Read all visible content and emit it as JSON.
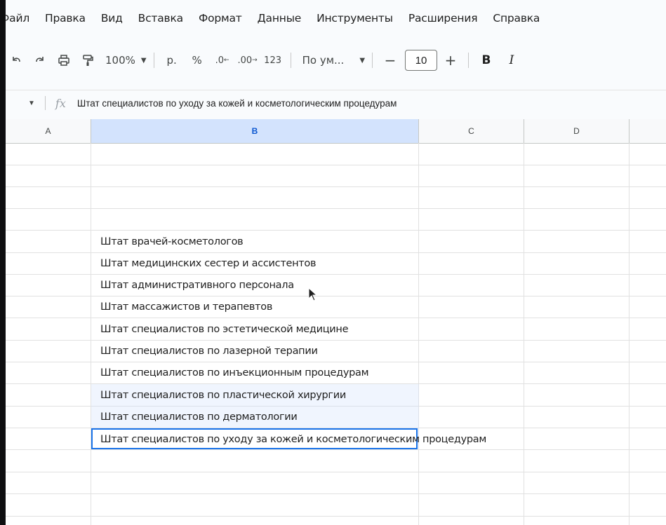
{
  "menu": [
    "Файл",
    "Правка",
    "Вид",
    "Вставка",
    "Формат",
    "Данные",
    "Инструменты",
    "Расширения",
    "Справка"
  ],
  "toolbar": {
    "undo_icon": "undo-icon",
    "redo_icon": "redo-icon",
    "print_icon": "print-icon",
    "paint_format_icon": "paint-format-icon",
    "zoom": "100%",
    "currency": "р.",
    "percent": "%",
    "decrease_decimals": ".0",
    "increase_decimals": ".00",
    "number_format": "123",
    "font": "По ум...",
    "decrease_size": "−",
    "font_size": "10",
    "increase_size": "+",
    "bold": "B",
    "italic": "I"
  },
  "formula_bar": {
    "fx_label": "fx",
    "content": "Штат специалистов по уходу за кожей и косметологическим процедурам"
  },
  "columns": [
    {
      "label": "A",
      "selected": false
    },
    {
      "label": "B",
      "selected": true
    },
    {
      "label": "C",
      "selected": false
    },
    {
      "label": "D",
      "selected": false
    }
  ],
  "cells_column_b": [
    "Штат врачей-косметологов",
    "Штат медицинских сестер и ассистентов",
    "Штат административного персонала",
    "Штат массажистов и терапевтов",
    "Штат специалистов по эстетической медицине",
    "Штат специалистов по лазерной терапии",
    "Штат специалистов по инъекционным процедурам",
    "Штат специалистов по пластической хирургии",
    "Штат специалистов по дерматологии",
    "Штат специалистов по уходу за кожей и косметологическим процедурам"
  ],
  "colors": {
    "accent": "#1a73e8",
    "selection": "#d3e3fd"
  }
}
